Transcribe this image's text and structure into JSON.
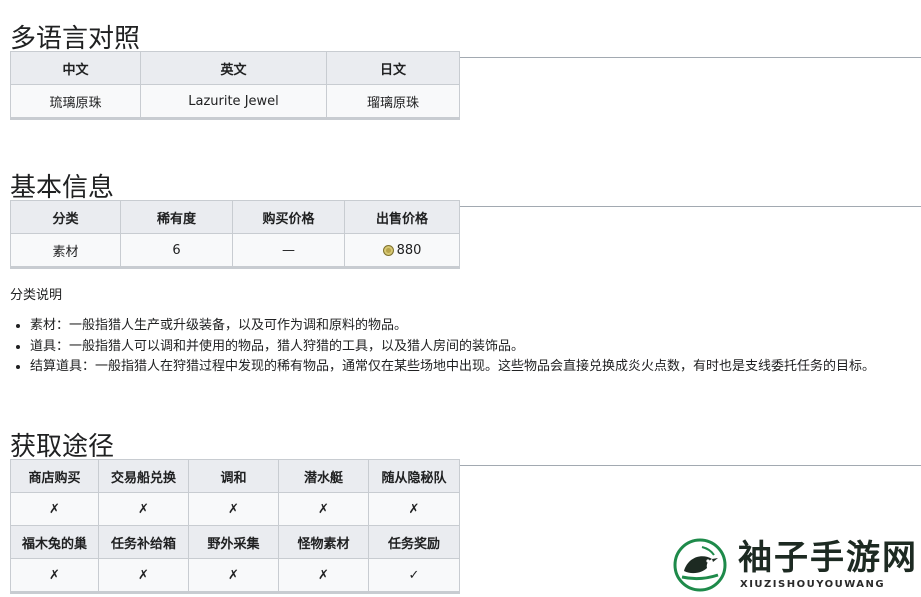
{
  "sections": {
    "multilang": {
      "title": "多语言对照",
      "headers": [
        "中文",
        "英文",
        "日文"
      ],
      "row": [
        "琉璃原珠",
        "Lazurite Jewel",
        "瑠璃原珠"
      ]
    },
    "basic": {
      "title": "基本信息",
      "headers": [
        "分类",
        "稀有度",
        "购买价格",
        "出售价格"
      ],
      "row": [
        "素材",
        "6",
        "—",
        "880"
      ],
      "sell_icon": "coin-icon"
    },
    "category_note": {
      "label": "分类说明",
      "items": [
        "素材：一般指猎人生产或升级装备，以及可作为调和原料的物品。",
        "道具：一般指猎人可以调和并使用的物品，猎人狩猎的工具，以及猎人房间的装饰品。",
        "结算道具：一般指猎人在狩猎过程中发现的稀有物品，通常仅在某些场地中出现。这些物品会直接兑换成炎火点数，有时也是支线委托任务的目标。"
      ]
    },
    "acquire": {
      "title": "获取途径",
      "headers1": [
        "商店购买",
        "交易船兑换",
        "调和",
        "潜水艇",
        "随从隐秘队"
      ],
      "row1": [
        "✗",
        "✗",
        "✗",
        "✗",
        "✗"
      ],
      "headers2": [
        "福木兔的巢",
        "任务补给箱",
        "野外采集",
        "怪物素材",
        "任务奖励"
      ],
      "row2": [
        "✗",
        "✗",
        "✗",
        "✗",
        "✓"
      ]
    }
  },
  "watermark": {
    "name": "袖子手游网",
    "sub": "XIUZISHOUYOUWANG",
    "icon": "bird-logo-icon"
  },
  "colors": {
    "cross": "#dd3333",
    "check": "#00af89",
    "header_bg": "#eaecf0",
    "cell_bg": "#f8f9fa",
    "border": "#c8ccd1"
  }
}
